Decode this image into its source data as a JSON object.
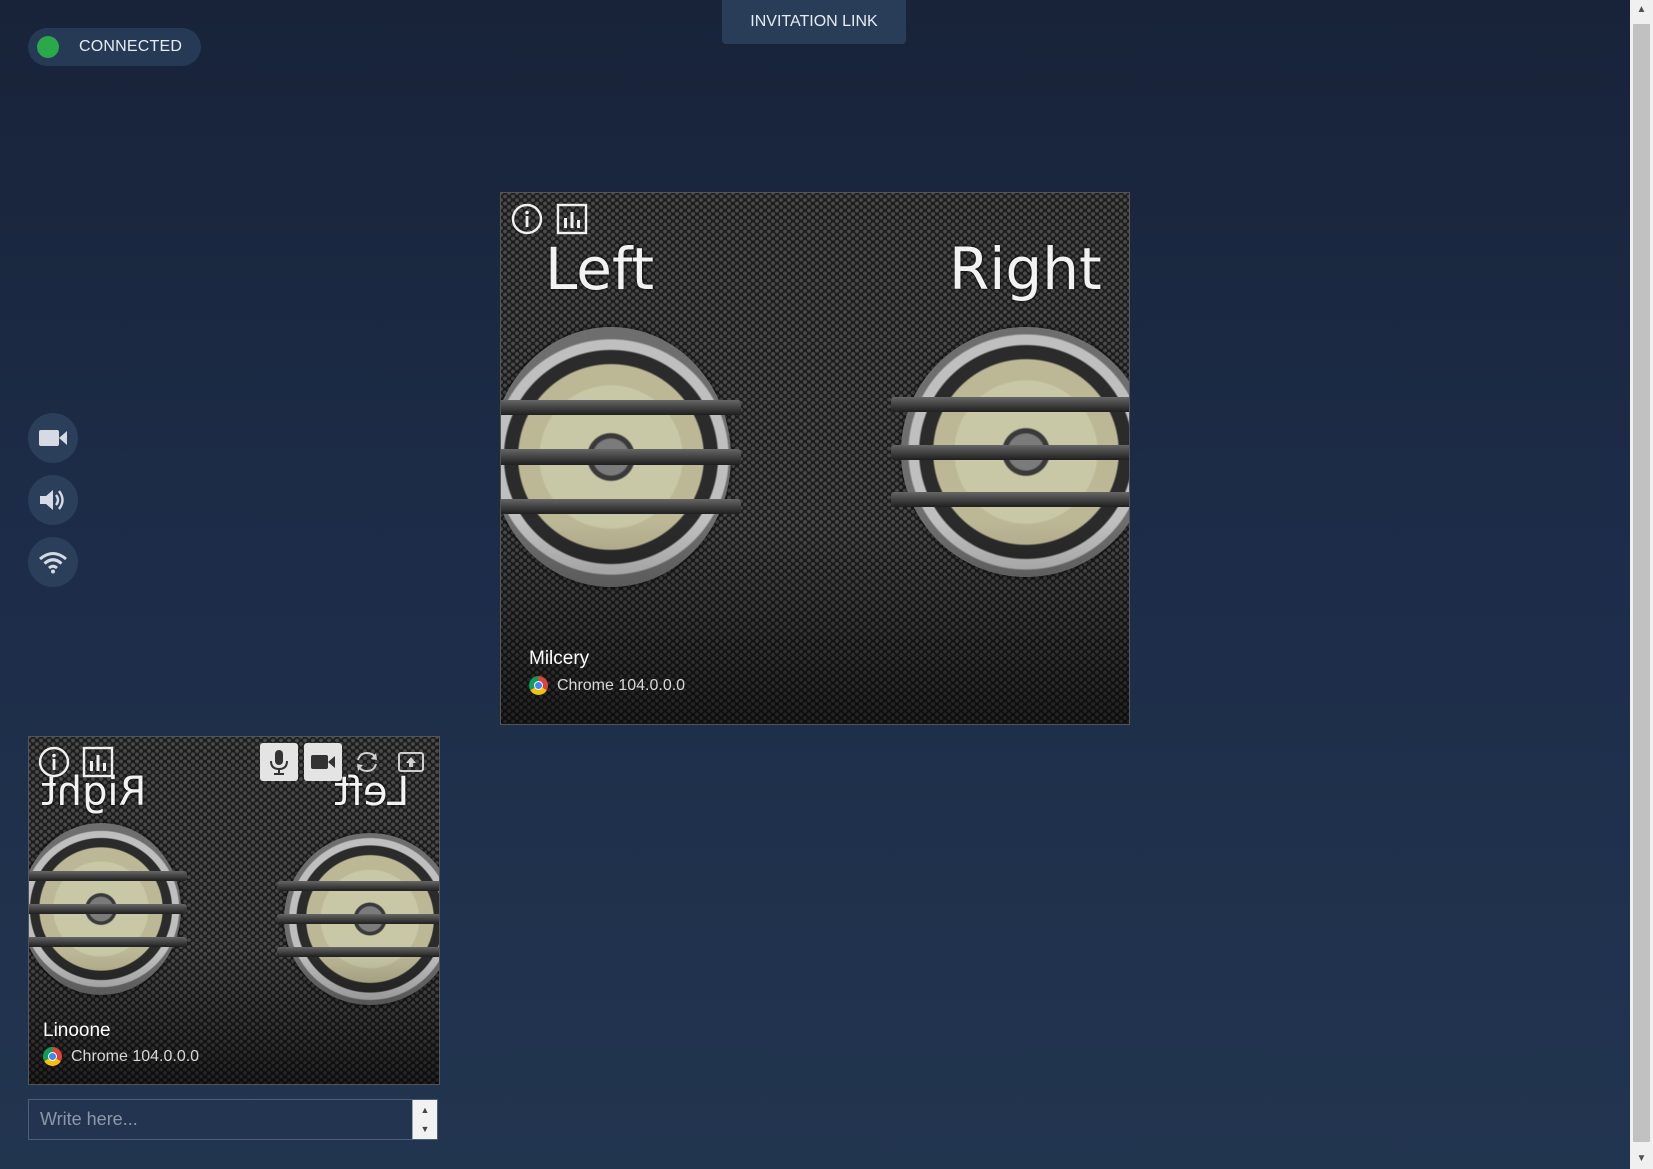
{
  "status": {
    "label": "CONNECTED",
    "color": "#2ba84a"
  },
  "header": {
    "invite_label": "INVITATION LINK"
  },
  "side_controls": [
    {
      "name": "camera-icon"
    },
    {
      "name": "speaker-icon"
    },
    {
      "name": "wifi-icon"
    }
  ],
  "remote_peer": {
    "name": "Milcery",
    "browser": "Chrome 104.0.0.0",
    "left_label": "Left",
    "right_label": "Right"
  },
  "local_peer": {
    "name": "Linoone",
    "browser": "Chrome 104.0.0.0",
    "left_label": "Left",
    "right_label": "Right"
  },
  "chat": {
    "placeholder": "Write here..."
  }
}
